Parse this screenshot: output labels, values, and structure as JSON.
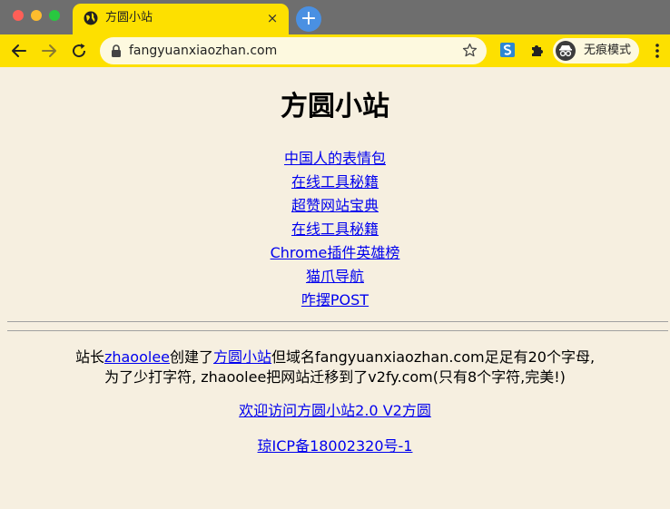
{
  "browser": {
    "tab_title": "方圆小站",
    "tab_close": "×",
    "new_tab": "+",
    "url": "fangyuanxiaozhan.com",
    "incognito_label": "无痕模式",
    "icons": [
      "back-icon",
      "forward-icon",
      "reload-icon",
      "lock-icon",
      "star-icon",
      "extension-icon",
      "puzzle-icon",
      "incognito-icon",
      "menu-icon"
    ]
  },
  "page": {
    "title": "方圆小站",
    "links": [
      "中国人的表情包",
      "在线工具秘籍",
      "超赞网站宝典",
      "在线工具秘籍",
      "Chrome插件英雄榜",
      "猫爪导航",
      "咋摆POST"
    ],
    "intro": {
      "t1": "站长",
      "link_author": "zhaoolee",
      "t2": "创建了",
      "link_site": "方圆小站",
      "t3": "但域名fangyuanxiaozhan.com足足有20个字母,",
      "line2": "为了少打字符, zhaoolee把网站迁移到了v2fy.com(只有8个字符,完美!)"
    },
    "visit_link": "欢迎访问方圆小站2.0 V2方圆",
    "icp_link": "琼ICP备18002320号-1"
  }
}
